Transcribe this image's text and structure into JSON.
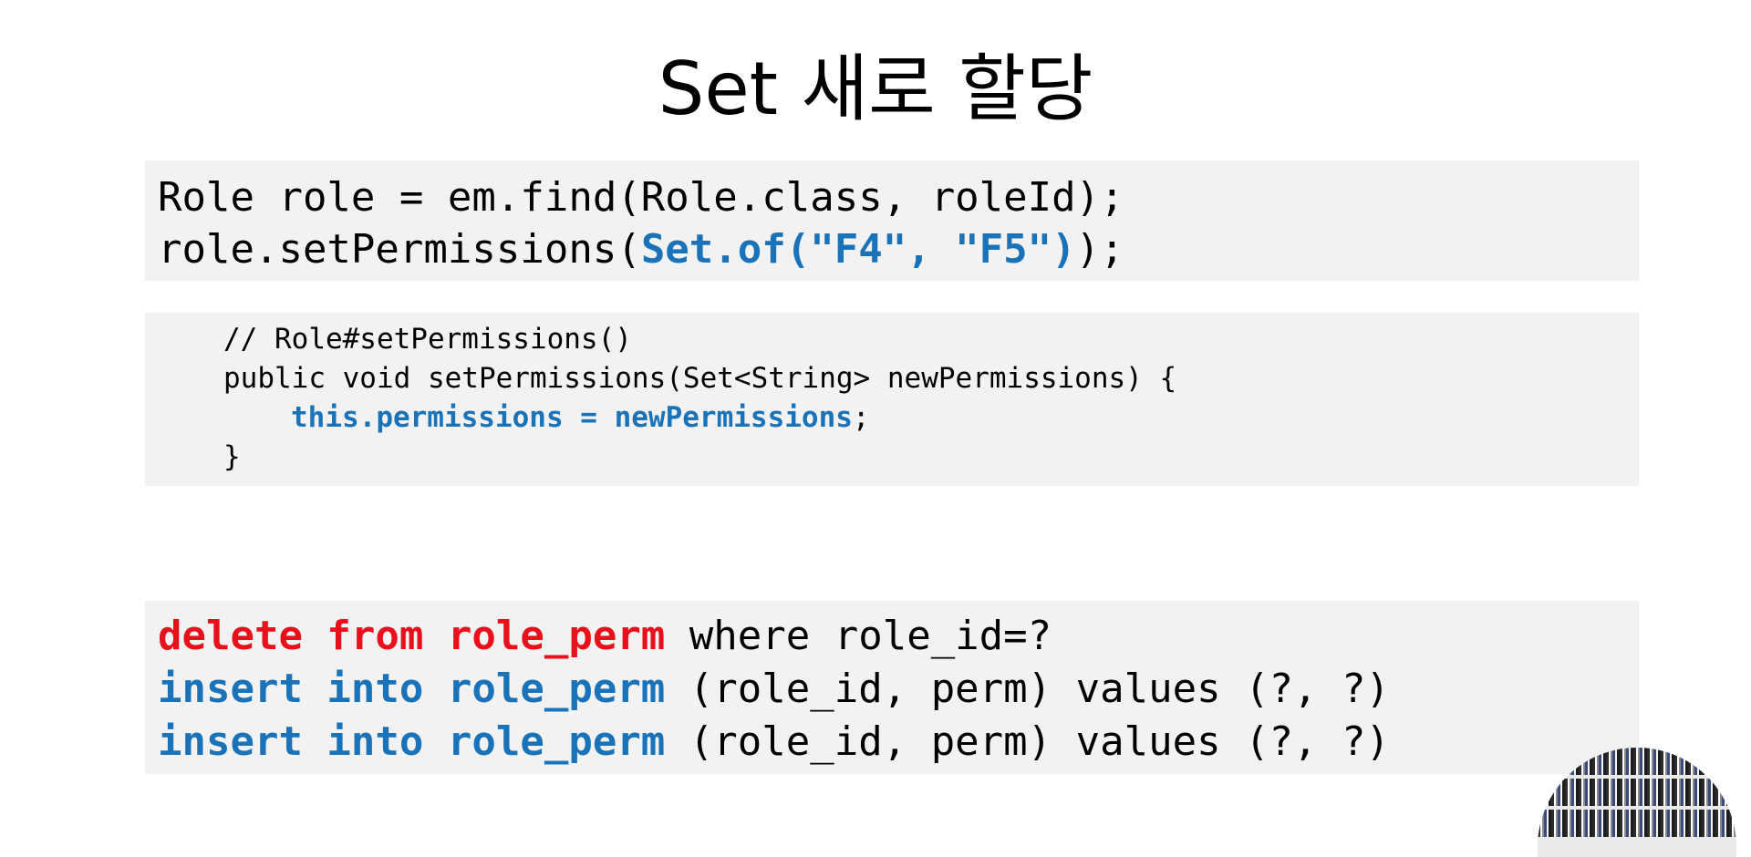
{
  "title": "Set 새로 할당",
  "code_java": {
    "line1": "Role role = em.find(Role.class, roleId);",
    "line2_pre": "role.setPermissions(",
    "line2_hl": "Set.of(\"F4\", \"F5\")",
    "line2_post": ");"
  },
  "code_method": {
    "comment": "// Role#setPermissions()",
    "signature": "public void setPermissions(Set<String> newPermissions) {",
    "body_hl": "this.permissions = newPermissions",
    "body_post": ";",
    "close": "}"
  },
  "code_sql": {
    "delete_kw": "delete from role_perm",
    "delete_rest": " where role_id=?",
    "insert1_kw": "insert into role_perm",
    "insert1_rest": " (role_id, perm) values (?, ?)",
    "insert2_kw": "insert into role_perm",
    "insert2_rest": " (role_id, perm) values (?, ?)"
  },
  "colors": {
    "highlight_blue": "#1a73b8",
    "delete_red": "#e8101a",
    "code_background": "#f2f2f2"
  }
}
